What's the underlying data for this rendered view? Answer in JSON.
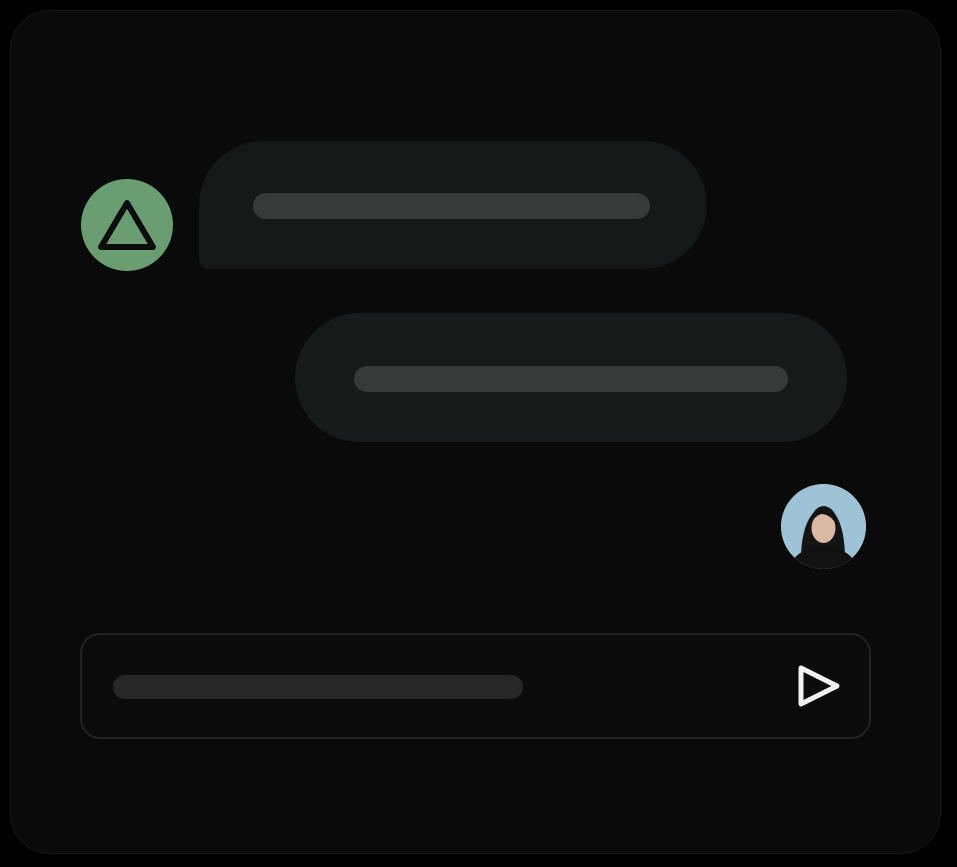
{
  "conversation": {
    "messages": [
      {
        "role": "assistant",
        "avatar_icon": "triangle-logo-icon",
        "avatar_color": "#6a9e72"
      },
      {
        "role": "user",
        "avatar_icon": "user-photo-avatar",
        "avatar_color": "#8fb8cf"
      }
    ]
  },
  "composer": {
    "send_icon": "send-icon"
  },
  "colors": {
    "background": "#000000",
    "panel": "#0a0a0a",
    "bubble": "#151818",
    "text_placeholder": "#363a3a",
    "accent_green": "#6a9e72"
  }
}
